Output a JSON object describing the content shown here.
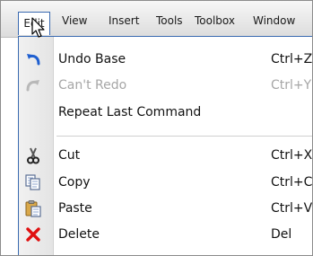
{
  "menubar": {
    "items": [
      {
        "label": "Edit"
      },
      {
        "label": "View"
      },
      {
        "label": "Insert"
      },
      {
        "label": "Tools"
      },
      {
        "label": "Toolbox"
      },
      {
        "label": "Window"
      }
    ],
    "active": "Edit"
  },
  "edit_menu": {
    "items": [
      {
        "label": "Undo Base",
        "shortcut": "Ctrl+Z",
        "icon": "undo-icon",
        "enabled": true
      },
      {
        "label": "Can't Redo",
        "shortcut": "Ctrl+Y",
        "icon": "redo-icon",
        "enabled": false
      },
      {
        "label": "Repeat Last Command",
        "shortcut": "",
        "icon": "",
        "enabled": true
      },
      {
        "label": "Cut",
        "shortcut": "Ctrl+X",
        "icon": "scissors-icon",
        "enabled": true
      },
      {
        "label": "Copy",
        "shortcut": "Ctrl+C",
        "icon": "copy-icon",
        "enabled": true
      },
      {
        "label": "Paste",
        "shortcut": "Ctrl+V",
        "icon": "paste-icon",
        "enabled": true
      },
      {
        "label": "Delete",
        "shortcut": "Del",
        "icon": "delete-icon",
        "enabled": true
      }
    ]
  },
  "colors": {
    "menu_border": "#3a6ab0",
    "disabled_text": "#a6a6a6",
    "delete_red": "#e01010"
  }
}
